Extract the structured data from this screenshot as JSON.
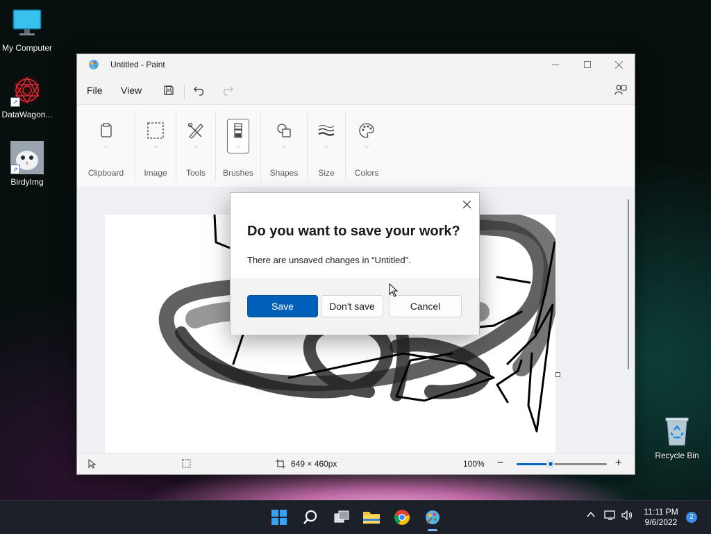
{
  "desktop": {
    "icons": [
      {
        "label": "My Computer"
      },
      {
        "label": "DataWagon..."
      },
      {
        "label": "BirdyImg"
      },
      {
        "label": "Recycle Bin"
      }
    ]
  },
  "window": {
    "title": "Untitled - Paint",
    "menu": {
      "file": "File",
      "view": "View"
    },
    "ribbon": {
      "groups": [
        "Clipboard",
        "Image",
        "Tools",
        "Brushes",
        "Shapes",
        "Size",
        "Colors"
      ]
    },
    "status": {
      "canvas_size": "649 × 460px",
      "zoom": "100%",
      "zoom_level_fraction": 0.38
    }
  },
  "dialog": {
    "heading": "Do you want to save your work?",
    "message": "There are unsaved changes in “Untitled”.",
    "save_label": "Save",
    "dont_save_label": "Don't save",
    "cancel_label": "Cancel"
  },
  "taskbar": {
    "time": "11:11 PM",
    "date": "9/6/2022",
    "notification_count": "2"
  },
  "colors": {
    "accent": "#005fb8"
  }
}
